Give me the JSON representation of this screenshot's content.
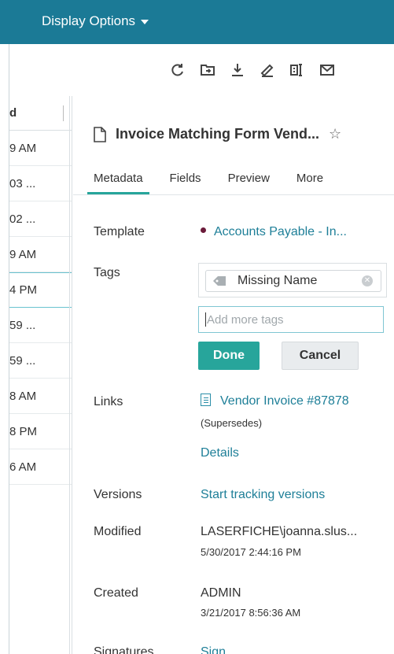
{
  "topbar": {
    "display_options": "Display Options"
  },
  "toolbar": {
    "icons": [
      "refresh-icon",
      "move-to-folder-icon",
      "download-icon",
      "annotate-icon",
      "ocr-icon",
      "email-icon"
    ]
  },
  "list": {
    "header": "d",
    "rows": [
      "9 AM",
      "03 ...",
      "02 ...",
      "9 AM",
      "4 PM",
      "59 ...",
      "59 ...",
      "8 AM",
      "8 PM",
      "6 AM"
    ]
  },
  "document": {
    "title": "Invoice Matching Form Vend...",
    "star": "☆"
  },
  "tabs": [
    "Metadata",
    "Fields",
    "Preview",
    "More"
  ],
  "metadata": {
    "template_label": "Template",
    "template_value": "Accounts Payable - In...",
    "tags_label": "Tags",
    "tag_chip": "Missing Name",
    "tag_placeholder": "Add more tags",
    "done_label": "Done",
    "cancel_label": "Cancel",
    "links_label": "Links",
    "link_value": "Vendor Invoice #87878",
    "link_sub": "(Supersedes)",
    "details_label": "Details",
    "versions_label": "Versions",
    "versions_value": "Start tracking versions",
    "modified_label": "Modified",
    "modified_user": "LASERFICHE\\joanna.slus...",
    "modified_date": "5/30/2017 2:44:16 PM",
    "created_label": "Created",
    "created_user": "ADMIN",
    "created_date": "3/21/2017 8:56:36 AM",
    "signatures_label": "Signatures",
    "signatures_value": "Sign"
  },
  "colors": {
    "topbar": "#1b7a96",
    "accent": "#27a59b",
    "link": "#1e7f98"
  }
}
